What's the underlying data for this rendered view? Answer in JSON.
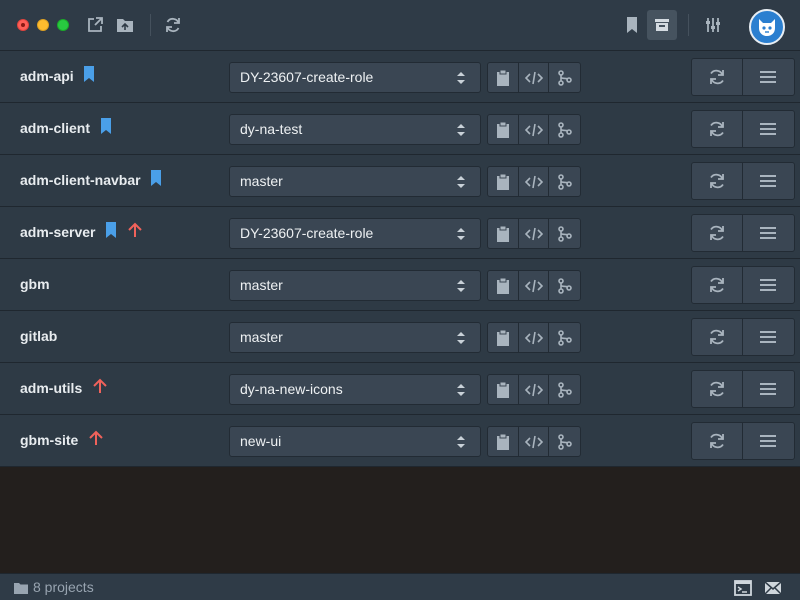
{
  "window": {
    "colors": {
      "bookmark": "#4a9fe8",
      "ahead": "#f0625b",
      "icon": "#a9b4be"
    }
  },
  "toolbar": {
    "left_icons": [
      "open-external-icon",
      "open-folder-icon",
      "refresh-icon"
    ],
    "right_icons": [
      "bookmark-icon",
      "archive-icon",
      "sliders-icon"
    ],
    "avatar_icon": "github-octocat-icon"
  },
  "projects": [
    {
      "name": "adm-api",
      "bookmarked": true,
      "ahead": false,
      "branch": "DY-23607-create-role"
    },
    {
      "name": "adm-client",
      "bookmarked": true,
      "ahead": false,
      "branch": "dy-na-test"
    },
    {
      "name": "adm-client-navbar",
      "bookmarked": true,
      "ahead": false,
      "branch": "master"
    },
    {
      "name": "adm-server",
      "bookmarked": true,
      "ahead": true,
      "branch": "DY-23607-create-role"
    },
    {
      "name": "gbm",
      "bookmarked": false,
      "ahead": false,
      "branch": "master"
    },
    {
      "name": "gitlab",
      "bookmarked": false,
      "ahead": false,
      "branch": "master"
    },
    {
      "name": "adm-utils",
      "bookmarked": false,
      "ahead": true,
      "branch": "dy-na-new-icons"
    },
    {
      "name": "gbm-site",
      "bookmarked": false,
      "ahead": true,
      "branch": "new-ui"
    }
  ],
  "row_actions": {
    "group_icons": [
      "clipboard-icon",
      "code-icon",
      "git-fork-icon"
    ],
    "action_icons": [
      "sync-icon",
      "menu-icon"
    ]
  },
  "statusbar": {
    "count_label": "8 projects",
    "right_icons": [
      "terminal-icon",
      "mail-icon"
    ]
  }
}
